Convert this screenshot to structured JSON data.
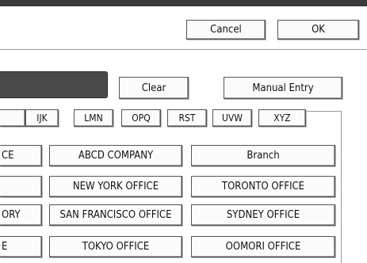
{
  "header": {
    "cancel_label": "Cancel",
    "ok_label": "OK"
  },
  "name_area": {
    "clear_label": "Clear",
    "manual_entry_label": "Manual Entry"
  },
  "index_tabs": [
    "IJK",
    "LMN",
    "OPQ",
    "RST",
    "UVW",
    "XYZ"
  ],
  "destinations": [
    [
      "CE",
      "ABCD COMPANY",
      "Branch"
    ],
    [
      "",
      "NEW YORK OFFICE",
      "TORONTO OFFICE"
    ],
    [
      "ORY",
      "SAN FRANCISCO OFFICE",
      "SYDNEY OFFICE"
    ],
    [
      "E",
      "TOKYO OFFICE",
      "OOMORI OFFICE"
    ]
  ]
}
